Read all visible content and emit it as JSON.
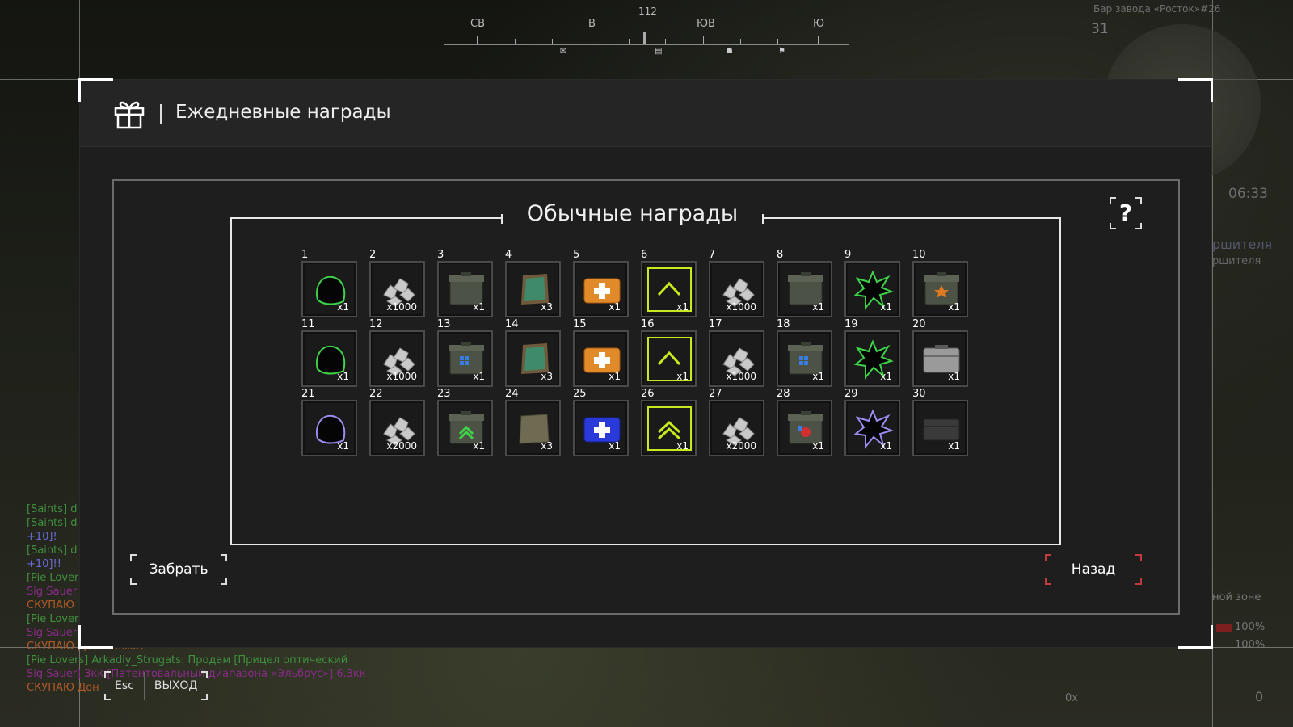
{
  "hud": {
    "compass": {
      "bearing": "112",
      "directions": [
        {
          "label": "СВ"
        },
        {
          "label": "В"
        },
        {
          "label": "ЮВ"
        },
        {
          "label": "Ю"
        }
      ]
    },
    "location": "Бар завода «Росток»#26",
    "ping": "31",
    "time": "06:33",
    "quest_title_partial": "ршителя",
    "quest_sub_partial": "ршителя",
    "zone_text_partial": "ной зоне",
    "stat1": "100%",
    "stat2": "100%",
    "bottom_right_value": "0",
    "bottom_right_label": "0x"
  },
  "chat": [
    {
      "text": "[Saints] d",
      "color": "#3f8f3f"
    },
    {
      "text": "[Saints] d",
      "color": "#3f8f3f"
    },
    {
      "text": "+10]!",
      "color": "#6a6ad8"
    },
    {
      "text": "[Saints] d",
      "color": "#3f8f3f"
    },
    {
      "text": "+10]!!",
      "color": "#6a6ad8"
    },
    {
      "text": "[Pie Lovers",
      "color": "#3f8f3f"
    },
    {
      "text": "Sig Sauer",
      "color": "#8a2a8a"
    },
    {
      "text": "СКУПАЮ",
      "color": "#b05a2a"
    },
    {
      "text": "[Pie Lovers",
      "color": "#3f8f3f"
    },
    {
      "text": "Sig Sauer",
      "color": "#8a2a8a"
    },
    {
      "text": "СКУПАЮ Донат шмот",
      "color": "#b05a2a"
    },
    {
      "text": "[Pie Lovers] Arkadiy_Strugats: Продам [Прицел оптический",
      "color": "#3f8f3f"
    },
    {
      "text": "Sig Sauer] 3кк [Патентовальный диапазона «Эльбрус»] 6.3кк",
      "color": "#8a2a8a"
    },
    {
      "text": "СКУПАЮ Дон",
      "color": "#b05a2a"
    }
  ],
  "dialog": {
    "title": "Ежедневные награды",
    "section_title": "Обычные награды",
    "help_label": "?",
    "claim_label": "Забрать",
    "back_label": "Назад"
  },
  "footer": {
    "esc_key": "Esc",
    "exit_label": "ВЫХОД"
  },
  "rewards": [
    {
      "day": "1",
      "icon": "helmet-green-icon",
      "count": "x1"
    },
    {
      "day": "2",
      "icon": "silver-ore-icon",
      "count": "x1000"
    },
    {
      "day": "3",
      "icon": "ammo-box-icon",
      "count": "x1"
    },
    {
      "day": "4",
      "icon": "map-scroll-icon",
      "count": "x3"
    },
    {
      "day": "5",
      "icon": "orange-medkit-icon",
      "count": "x1"
    },
    {
      "day": "6",
      "icon": "upgrade-chevron-icon",
      "count": "x1"
    },
    {
      "day": "7",
      "icon": "silver-ore-icon",
      "count": "x1000"
    },
    {
      "day": "8",
      "icon": "ammo-box-icon",
      "count": "x1"
    },
    {
      "day": "9",
      "icon": "splat-green-icon",
      "count": "x1"
    },
    {
      "day": "10",
      "icon": "ammo-box-orange-icon",
      "count": "x1"
    },
    {
      "day": "11",
      "icon": "helmet-green-icon",
      "count": "x1"
    },
    {
      "day": "12",
      "icon": "silver-ore-icon",
      "count": "x1000"
    },
    {
      "day": "13",
      "icon": "ammo-box-blue-icon",
      "count": "x1"
    },
    {
      "day": "14",
      "icon": "map-scroll-icon",
      "count": "x3"
    },
    {
      "day": "15",
      "icon": "orange-medkit-icon",
      "count": "x1"
    },
    {
      "day": "16",
      "icon": "upgrade-chevron-icon",
      "count": "x1"
    },
    {
      "day": "17",
      "icon": "silver-ore-icon",
      "count": "x1000"
    },
    {
      "day": "18",
      "icon": "ammo-box-blue-icon",
      "count": "x1"
    },
    {
      "day": "19",
      "icon": "splat-green-icon",
      "count": "x1"
    },
    {
      "day": "20",
      "icon": "metal-case-icon",
      "count": "x1"
    },
    {
      "day": "21",
      "icon": "helmet-purple-icon",
      "count": "x1"
    },
    {
      "day": "22",
      "icon": "silver-ore-icon",
      "count": "x2000"
    },
    {
      "day": "23",
      "icon": "ammo-box-green-icon",
      "count": "x1"
    },
    {
      "day": "24",
      "icon": "ration-pack-icon",
      "count": "x3"
    },
    {
      "day": "25",
      "icon": "blue-medkit-icon",
      "count": "x1"
    },
    {
      "day": "26",
      "icon": "double-chevron-icon",
      "count": "x1"
    },
    {
      "day": "27",
      "icon": "silver-ore-icon",
      "count": "x2000"
    },
    {
      "day": "28",
      "icon": "ammo-box-red-icon",
      "count": "x1"
    },
    {
      "day": "29",
      "icon": "splat-purple-icon",
      "count": "x1"
    },
    {
      "day": "30",
      "icon": "dark-case-icon",
      "count": "x1"
    }
  ]
}
